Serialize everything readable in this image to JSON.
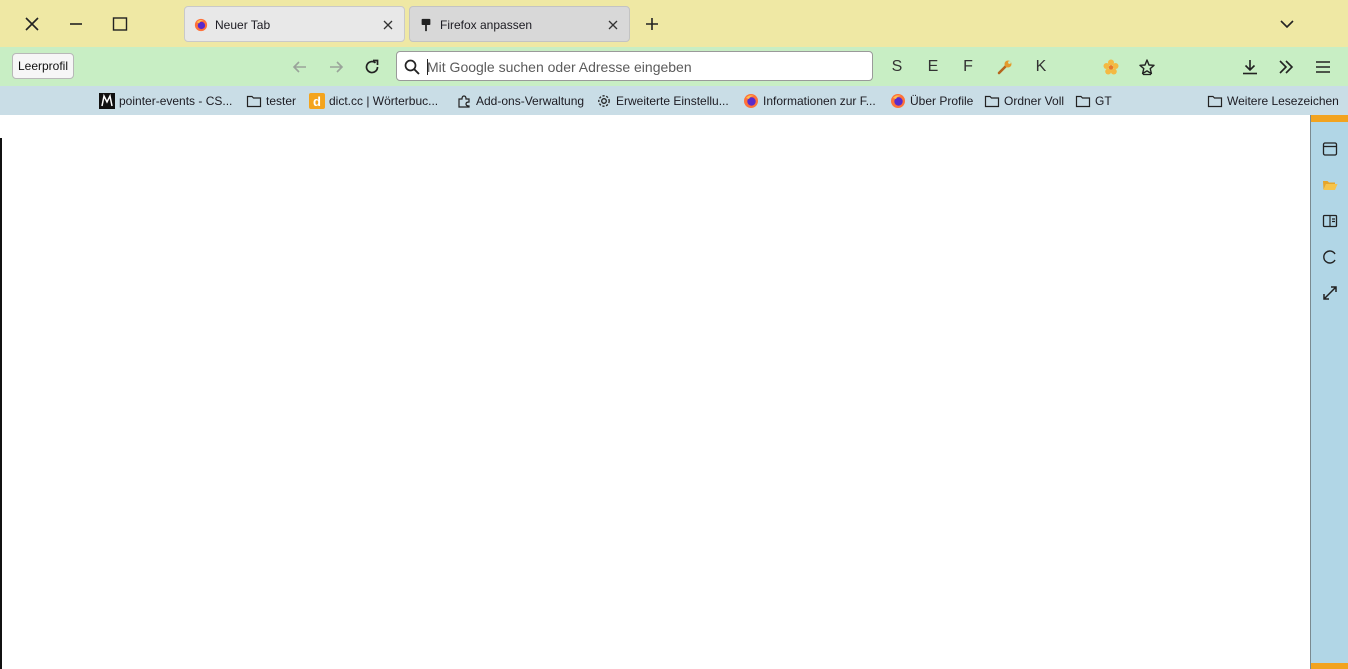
{
  "tabs": [
    {
      "title": "Neuer Tab",
      "icon": "firefox-icon",
      "active": true
    },
    {
      "title": "Firefox anpassen",
      "icon": "paintbrush-icon",
      "active": false
    }
  ],
  "navbar": {
    "profile_label": "Leerprofil",
    "url_placeholder": "Mit Google suchen oder Adresse eingeben",
    "url_value": "",
    "letter_buttons": [
      "S",
      "E",
      "F",
      "K"
    ]
  },
  "bookmarks": [
    {
      "label": "pointer-events - CS...",
      "icon": "mdn-icon"
    },
    {
      "label": "tester",
      "icon": "folder-icon"
    },
    {
      "label": "dict.cc | Wörterbuc...",
      "icon": "dictcc-icon"
    },
    {
      "label": "Add-ons-Verwaltung",
      "icon": "puzzle-icon"
    },
    {
      "label": "Erweiterte Einstellu...",
      "icon": "gear-icon"
    },
    {
      "label": "Informationen zur F...",
      "icon": "firefox-icon"
    },
    {
      "label": "Über Profile",
      "icon": "firefox-icon"
    },
    {
      "label": "Ordner Voll",
      "icon": "folder-icon"
    },
    {
      "label": "GT",
      "icon": "folder-icon"
    }
  ],
  "other_bookmarks": {
    "label": "Weitere Lesezeichen",
    "icon": "folder-icon"
  },
  "colors": {
    "tabbar_bg": "#efe8a4",
    "navbar_bg": "#c8eec4",
    "bookmarks_bg": "#c9dde6",
    "sidebar_bg": "#b1d6e6",
    "sidebar_accent": "#f2a31f"
  }
}
